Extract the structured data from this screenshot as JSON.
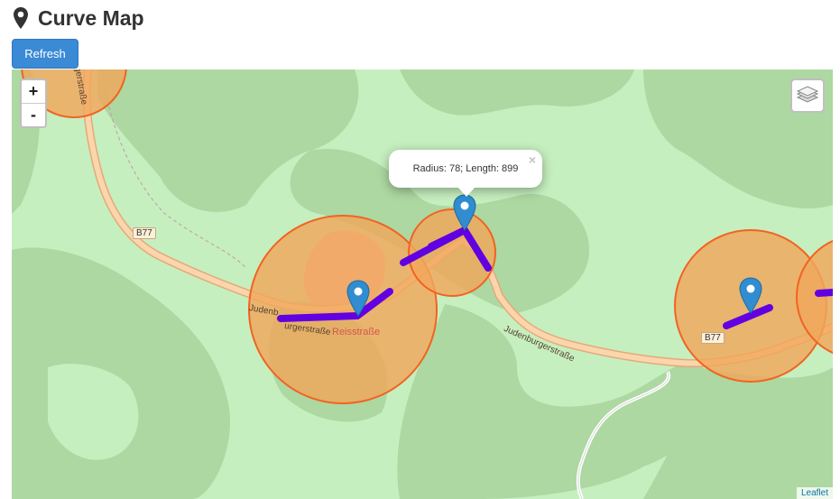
{
  "header": {
    "title": "Curve Map",
    "icon": "map-marker-icon"
  },
  "toolbar": {
    "refresh_label": "Refresh"
  },
  "map": {
    "zoom_in_label": "+",
    "zoom_out_label": "-",
    "layers_icon": "layers-icon",
    "popup": {
      "text": "Radius: 78; Length: 899",
      "close_label": "×"
    },
    "road_labels": {
      "b77_left": "B77",
      "b77_right": "B77",
      "judenburger_right": "Judenburgerstraße",
      "judenburger_left": "Judenb",
      "judenburger_left2": "urgerstraße",
      "reisstrasse": "Reisstraße",
      "gerstrasse_top": "gerstraße"
    },
    "attribution": "Leaflet",
    "colors": {
      "land": "#c6efbf",
      "forest": "#add8a1",
      "circle_fill": "#f0a75c",
      "circle_stroke": "#f26322",
      "curve": "#6100e0",
      "marker": "#2f8dd0",
      "road": "#f7c89a"
    }
  }
}
